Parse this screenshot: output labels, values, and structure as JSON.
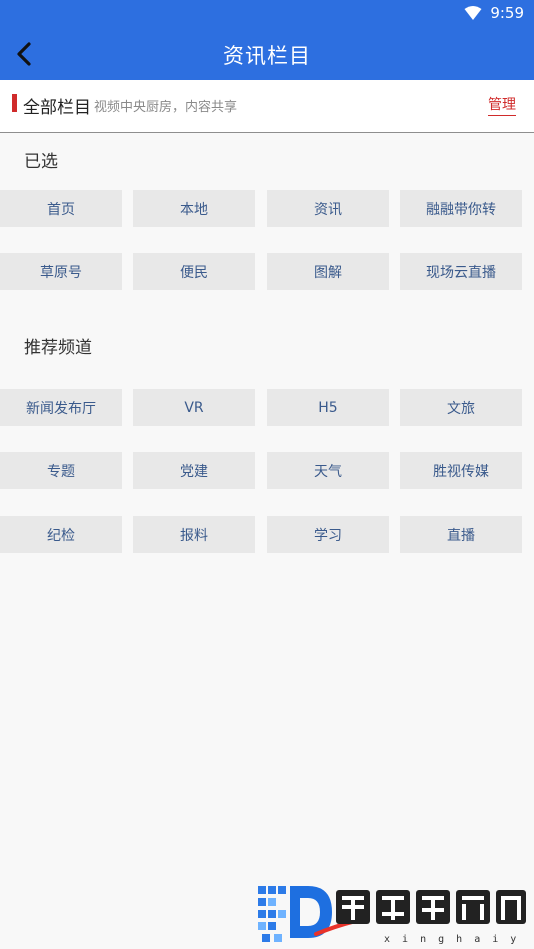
{
  "status": {
    "time": "9:59"
  },
  "header": {
    "title": "资讯栏目"
  },
  "all_columns": {
    "title": "全部栏目",
    "subtitle": "视频中央厨房，内容共享",
    "manage_label": "管理"
  },
  "selected": {
    "label": "已选",
    "items": [
      "首页",
      "本地",
      "资讯",
      "融融带你转",
      "草原号",
      "便民",
      "图解",
      "现场云直播"
    ]
  },
  "recommended": {
    "label": "推荐频道",
    "items": [
      "新闻发布厅",
      "VR",
      "H5",
      "文旅",
      "专题",
      "党建",
      "天气",
      "胜视传媒",
      "纪检",
      "报料",
      "学习",
      "直播"
    ]
  },
  "colors": {
    "primary": "#2d6fe0",
    "accent": "#d02b2b",
    "chip_bg": "#e8e8e8",
    "chip_text": "#3a5a8c"
  },
  "watermark": {
    "text": "鑫海手游网",
    "url": "xinghaiyx.com"
  }
}
